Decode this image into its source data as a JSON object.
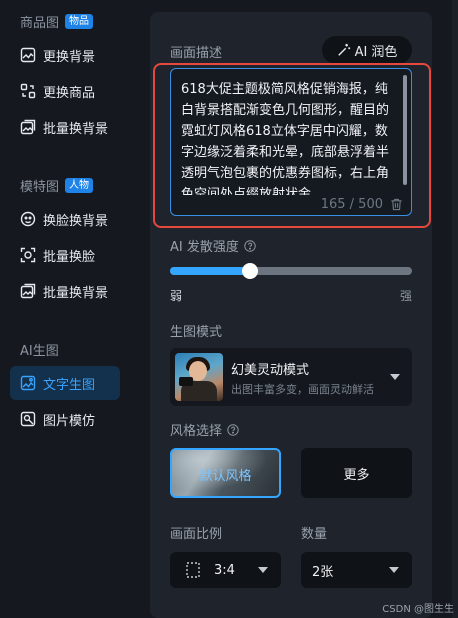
{
  "sidebar": {
    "sections": [
      {
        "title": "商品图",
        "badge": "物品",
        "items": [
          {
            "label": "更换背景"
          },
          {
            "label": "更换商品"
          },
          {
            "label": "批量换背景"
          }
        ]
      },
      {
        "title": "模特图",
        "badge": "人物",
        "items": [
          {
            "label": "换脸换背景"
          },
          {
            "label": "批量换脸"
          },
          {
            "label": "批量换背景"
          }
        ]
      },
      {
        "title": "AI生图",
        "items": [
          {
            "label": "文字生图",
            "active": true
          },
          {
            "label": "图片模仿"
          }
        ]
      }
    ]
  },
  "panel": {
    "description_label": "画面描述",
    "ai_polish_label": "AI 润色",
    "prompt_text": "618大促主题极简风格促销海报，纯白背景搭配渐变色几何图形，醒目的霓虹灯风格618立体字居中闪耀，数字边缘泛着柔和光晕，底部悬浮着半透明气泡包裹的优惠券图标，右上角色空间处点缀放射状金",
    "char_count": "165 / 500",
    "strength_label": "AI 发散强度",
    "strength_value": 0.33,
    "strength_min_label": "弱",
    "strength_max_label": "强",
    "mode_label": "生图模式",
    "mode_title": "幻美灵动模式",
    "mode_subtitle": "出图丰富多变，画面灵动鲜活",
    "style_label": "风格选择",
    "style_default_label": "默认风格",
    "style_more_label": "更多",
    "ratio_label": "画面比例",
    "ratio_value": "3:4",
    "count_label": "数量",
    "count_value": "2张"
  },
  "colors": {
    "accent": "#35a6ff",
    "highlight_border": "#e5483c",
    "active_bg": "#13304d"
  },
  "watermark": "CSDN @图生生"
}
